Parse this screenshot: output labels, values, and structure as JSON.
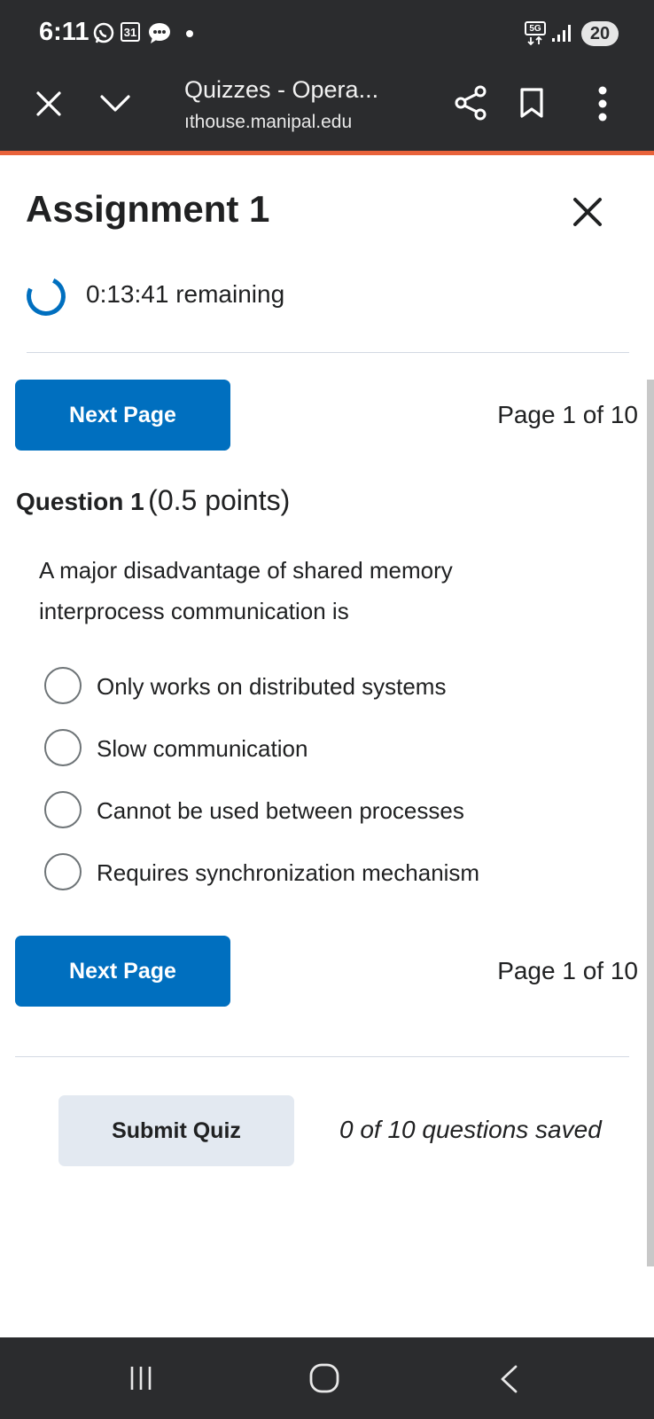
{
  "status_bar": {
    "time": "6:11",
    "icons": [
      "whatsapp-icon",
      "calendar-icon",
      "chat-icon",
      "notification-dot-icon",
      "network-5g-icon",
      "signal-icon"
    ],
    "calendar_day": "31",
    "network_type": "5G",
    "battery_level": "20"
  },
  "browser": {
    "title": "Quizzes - Opera...",
    "url": "ıthouse.manipal.edu",
    "icons": [
      "close-icon",
      "chevron-down-icon",
      "share-icon",
      "bookmark-icon",
      "more-vert-icon"
    ]
  },
  "quiz": {
    "heading": "Assignment 1",
    "timer": "0:13:41 remaining",
    "next_page_label": "Next Page",
    "page_indicator": "Page 1 of 10",
    "question_number": "Question 1",
    "question_points": "(0.5 points)",
    "question_text": "A major disadvantage of shared memory interprocess communication is",
    "options": [
      "Only works on distributed systems",
      "Slow communication",
      "Cannot be used between processes",
      "Requires synchronization mechanism"
    ],
    "submit_label": "Submit Quiz",
    "saved_status": "0 of 10 questions saved"
  },
  "nav_bar": {
    "icons": [
      "recent-apps-icon",
      "home-icon",
      "back-icon"
    ]
  },
  "colors": {
    "primary": "#006fbf",
    "chrome_dark": "#2b2c2e",
    "accent_orange": "#e8623a",
    "submit_bg": "#e3e9f1"
  }
}
